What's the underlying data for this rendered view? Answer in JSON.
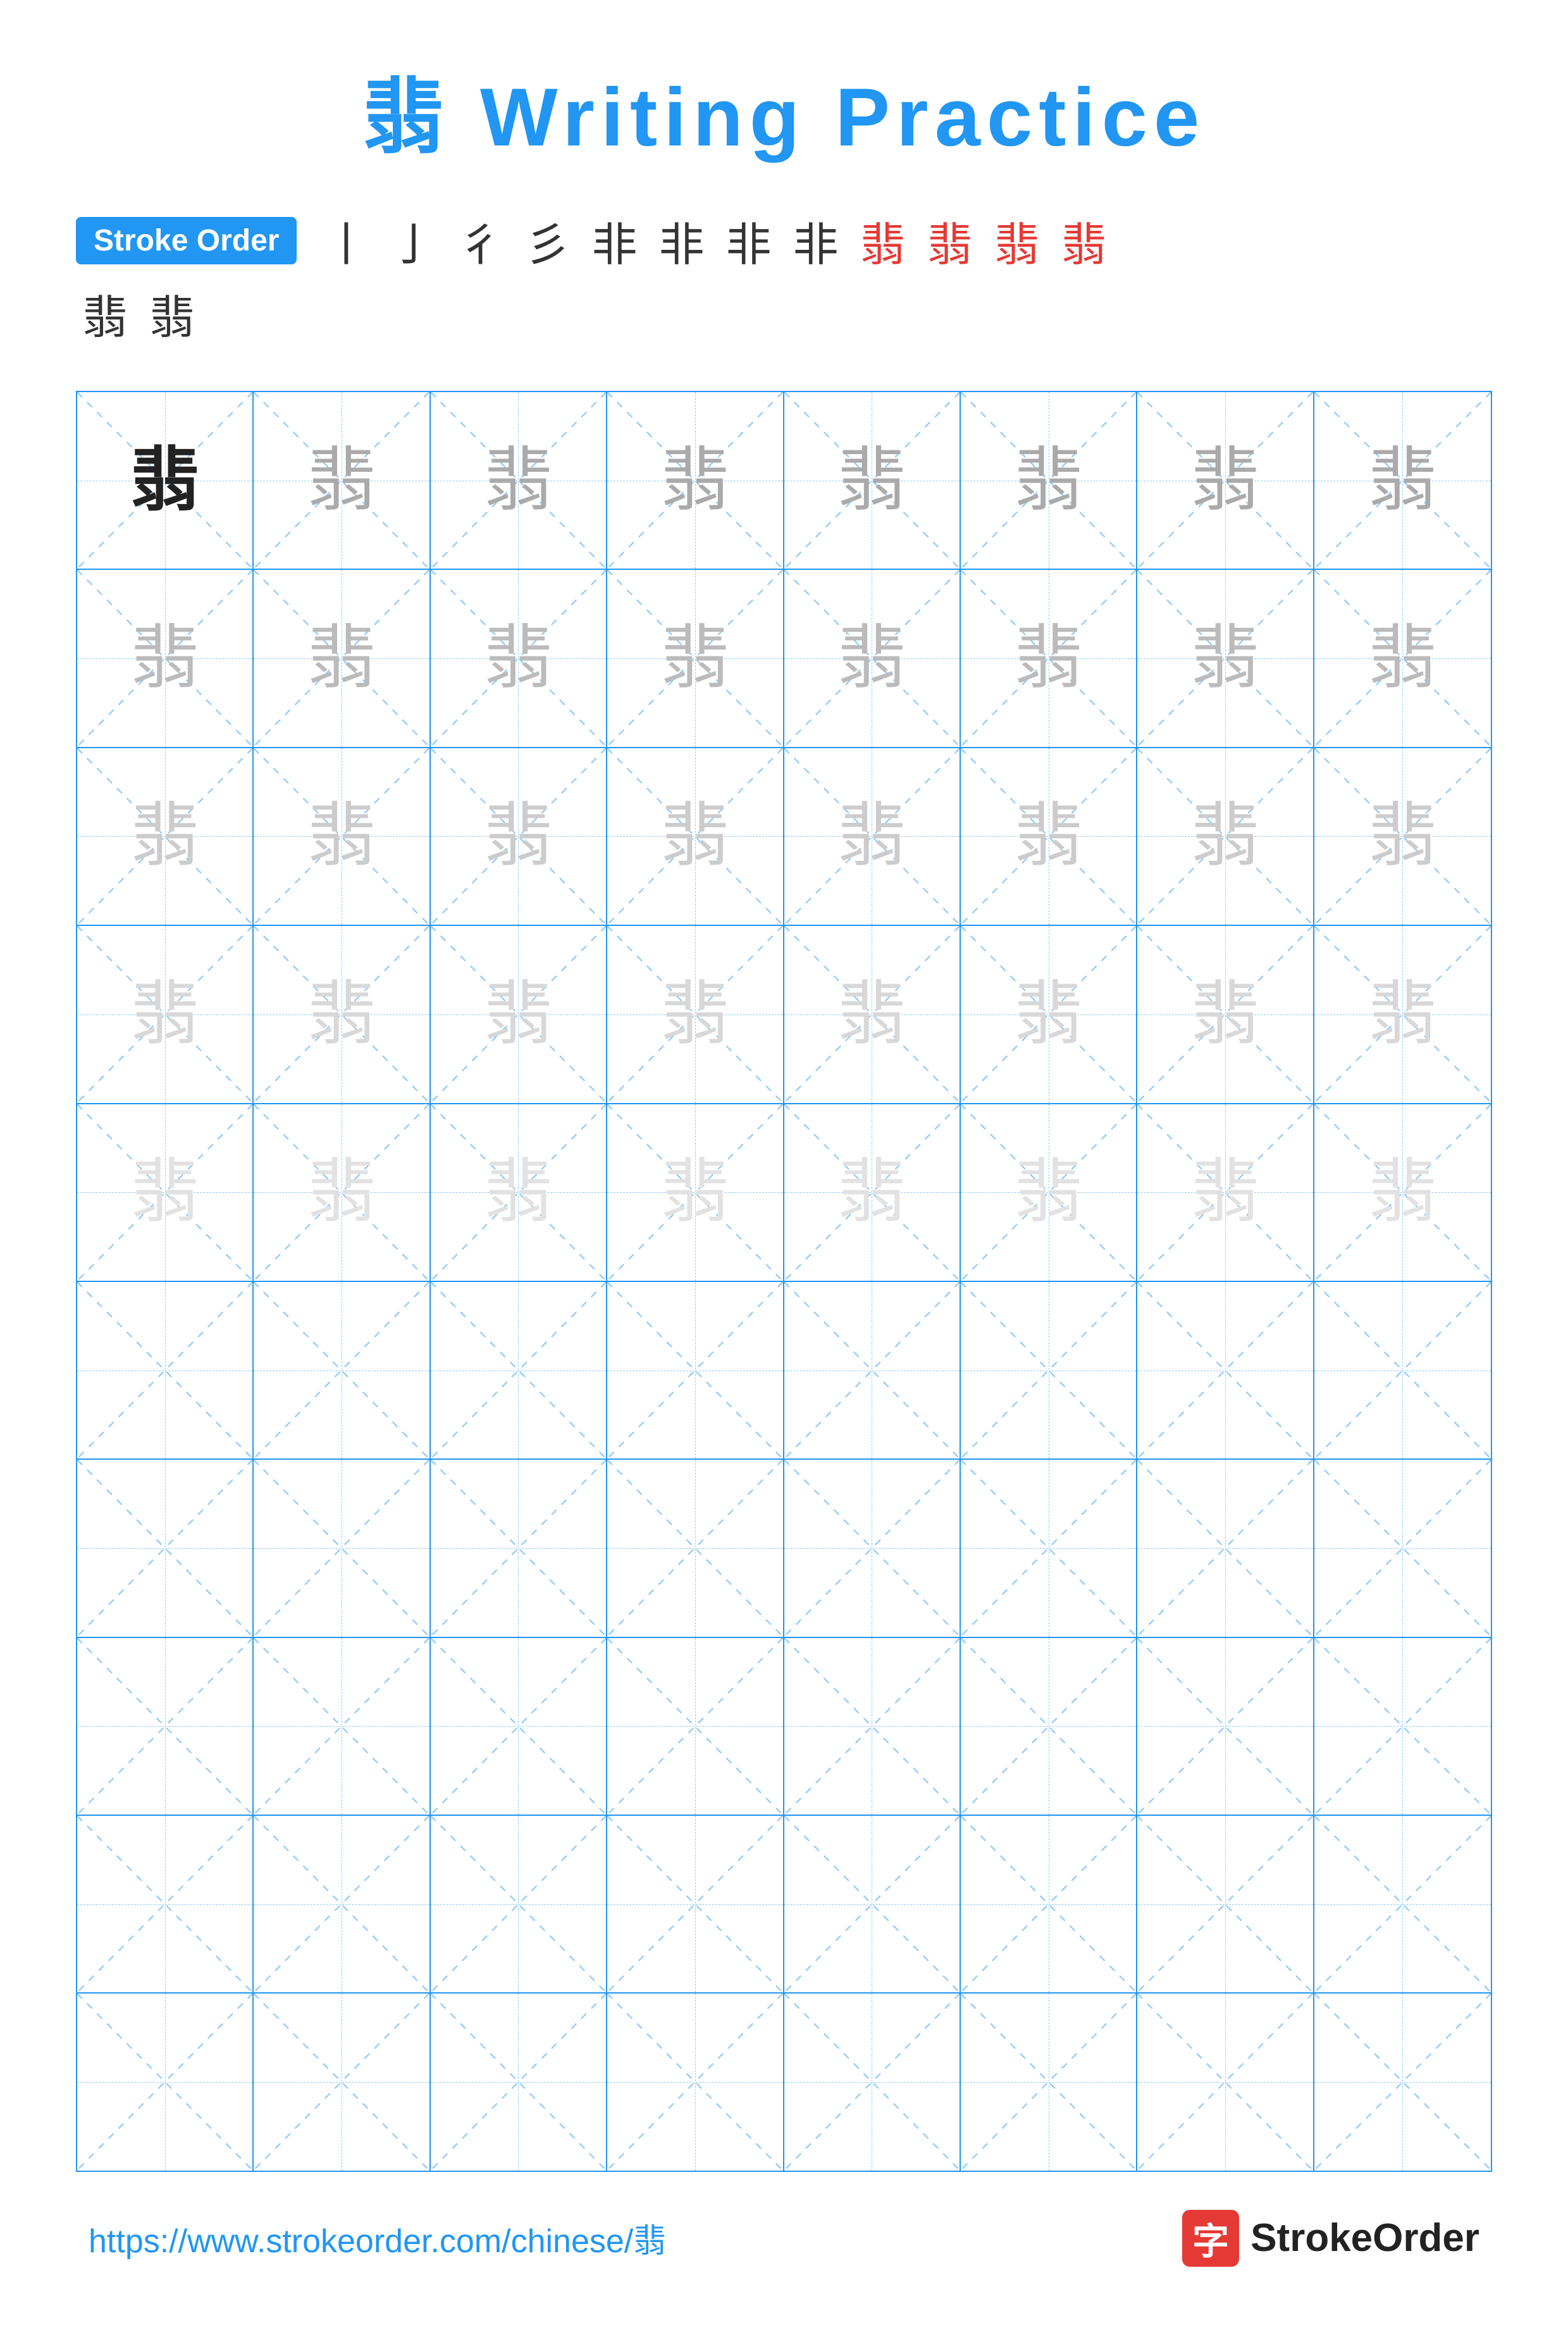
{
  "page": {
    "title": "翡 Writing Practice",
    "character": "翡",
    "stroke_order_label": "Stroke Order",
    "stroke_sequence": [
      "丨",
      "乛",
      "彳",
      "彡",
      "非",
      "非",
      "非",
      "非",
      "翡",
      "翡",
      "翡",
      "翡",
      "翡",
      "翡"
    ],
    "stroke_sequence_display": [
      "丨",
      "亅",
      "彳",
      "彡",
      "非",
      "非",
      "非",
      "非",
      "翡",
      "翡",
      "翡",
      "翡",
      "翡",
      "翡"
    ],
    "footer_url": "https://www.strokeorder.com/chinese/翡",
    "footer_brand": "StrokeOrder",
    "footer_brand_char": "字"
  },
  "grid": {
    "rows": 10,
    "cols": 8,
    "practice_char": "翡",
    "filled_rows": 5,
    "empty_rows": 5
  }
}
